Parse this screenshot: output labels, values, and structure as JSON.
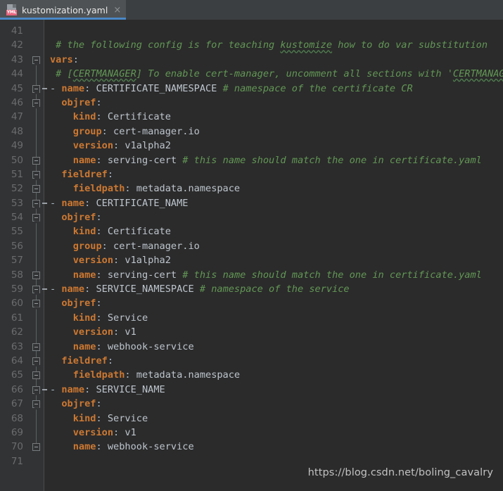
{
  "window": {
    "background": "#2b2b2b",
    "accent": "#4a88c7"
  },
  "tabbar": {
    "tabs": [
      {
        "filename": "kustomization.yaml",
        "icon": "yaml-file-icon",
        "badge_text": "YML",
        "close_glyph": "×",
        "active": true
      }
    ]
  },
  "editor": {
    "first_line_number": 41,
    "colors": {
      "key": "#cc7832",
      "value": "#bdc5cd",
      "comment": "#629755",
      "line_number": "#6a6c6e",
      "gutter_bg": "#313335",
      "editor_bg": "#2b2b2b"
    },
    "lines": [
      {
        "num": 41,
        "fold": "none",
        "segments": []
      },
      {
        "num": 42,
        "fold": "none",
        "segments": [
          {
            "t": "cmt",
            "text": " # the following config is for teaching "
          },
          {
            "t": "cmt-sp",
            "text": "kustomize"
          },
          {
            "t": "cmt",
            "text": " how to do var substitution"
          }
        ]
      },
      {
        "num": 43,
        "fold": "box-point",
        "segments": [
          {
            "t": "key",
            "text": "vars"
          },
          {
            "t": "punc",
            "text": ":"
          }
        ]
      },
      {
        "num": 44,
        "fold": "none",
        "segments": [
          {
            "t": "cmt",
            "text": " # ["
          },
          {
            "t": "cmt-sp",
            "text": "CERTMANAGER"
          },
          {
            "t": "cmt",
            "text": "] To enable cert-manager, uncomment all sections with '"
          },
          {
            "t": "cmt-sp",
            "text": "CERTMANAGER"
          },
          {
            "t": "cmt",
            "text": "'"
          }
        ]
      },
      {
        "num": 45,
        "fold": "box-point-dash",
        "segments": [
          {
            "t": "dash",
            "text": "- "
          },
          {
            "t": "key",
            "text": "name"
          },
          {
            "t": "punc",
            "text": ": "
          },
          {
            "t": "val",
            "text": "CERTIFICATE_NAMESPACE "
          },
          {
            "t": "cmt",
            "text": "# namespace of the certificate CR"
          }
        ]
      },
      {
        "num": 46,
        "fold": "box-point",
        "segments": [
          {
            "t": "plain",
            "text": "  "
          },
          {
            "t": "key",
            "text": "objref"
          },
          {
            "t": "punc",
            "text": ":"
          }
        ]
      },
      {
        "num": 47,
        "fold": "none",
        "segments": [
          {
            "t": "plain",
            "text": "    "
          },
          {
            "t": "key",
            "text": "kind"
          },
          {
            "t": "punc",
            "text": ": "
          },
          {
            "t": "val",
            "text": "Certificate"
          }
        ]
      },
      {
        "num": 48,
        "fold": "none",
        "segments": [
          {
            "t": "plain",
            "text": "    "
          },
          {
            "t": "key",
            "text": "group"
          },
          {
            "t": "punc",
            "text": ": "
          },
          {
            "t": "val",
            "text": "cert-manager.io"
          }
        ]
      },
      {
        "num": 49,
        "fold": "none",
        "segments": [
          {
            "t": "plain",
            "text": "    "
          },
          {
            "t": "key",
            "text": "version"
          },
          {
            "t": "punc",
            "text": ": "
          },
          {
            "t": "val",
            "text": "v1alpha2"
          }
        ]
      },
      {
        "num": 50,
        "fold": "box",
        "segments": [
          {
            "t": "plain",
            "text": "    "
          },
          {
            "t": "key",
            "text": "name"
          },
          {
            "t": "punc",
            "text": ": "
          },
          {
            "t": "val",
            "text": "serving-cert "
          },
          {
            "t": "cmt",
            "text": "# this name should match the one in certificate.yaml"
          }
        ]
      },
      {
        "num": 51,
        "fold": "box-point",
        "segments": [
          {
            "t": "plain",
            "text": "  "
          },
          {
            "t": "key",
            "text": "fieldref"
          },
          {
            "t": "punc",
            "text": ":"
          }
        ]
      },
      {
        "num": 52,
        "fold": "box",
        "segments": [
          {
            "t": "plain",
            "text": "    "
          },
          {
            "t": "key",
            "text": "fieldpath"
          },
          {
            "t": "punc",
            "text": ": "
          },
          {
            "t": "val",
            "text": "metadata.namespace"
          }
        ]
      },
      {
        "num": 53,
        "fold": "box-point-dash",
        "segments": [
          {
            "t": "dash",
            "text": "- "
          },
          {
            "t": "key",
            "text": "name"
          },
          {
            "t": "punc",
            "text": ": "
          },
          {
            "t": "val",
            "text": "CERTIFICATE_NAME"
          }
        ]
      },
      {
        "num": 54,
        "fold": "box-point",
        "segments": [
          {
            "t": "plain",
            "text": "  "
          },
          {
            "t": "key",
            "text": "objref"
          },
          {
            "t": "punc",
            "text": ":"
          }
        ]
      },
      {
        "num": 55,
        "fold": "none",
        "segments": [
          {
            "t": "plain",
            "text": "    "
          },
          {
            "t": "key",
            "text": "kind"
          },
          {
            "t": "punc",
            "text": ": "
          },
          {
            "t": "val",
            "text": "Certificate"
          }
        ]
      },
      {
        "num": 56,
        "fold": "none",
        "segments": [
          {
            "t": "plain",
            "text": "    "
          },
          {
            "t": "key",
            "text": "group"
          },
          {
            "t": "punc",
            "text": ": "
          },
          {
            "t": "val",
            "text": "cert-manager.io"
          }
        ]
      },
      {
        "num": 57,
        "fold": "none",
        "segments": [
          {
            "t": "plain",
            "text": "    "
          },
          {
            "t": "key",
            "text": "version"
          },
          {
            "t": "punc",
            "text": ": "
          },
          {
            "t": "val",
            "text": "v1alpha2"
          }
        ]
      },
      {
        "num": 58,
        "fold": "box",
        "segments": [
          {
            "t": "plain",
            "text": "    "
          },
          {
            "t": "key",
            "text": "name"
          },
          {
            "t": "punc",
            "text": ": "
          },
          {
            "t": "val",
            "text": "serving-cert "
          },
          {
            "t": "cmt",
            "text": "# this name should match the one in certificate.yaml"
          }
        ]
      },
      {
        "num": 59,
        "fold": "box-point-dash",
        "segments": [
          {
            "t": "dash",
            "text": "- "
          },
          {
            "t": "key",
            "text": "name"
          },
          {
            "t": "punc",
            "text": ": "
          },
          {
            "t": "val",
            "text": "SERVICE_NAMESPACE "
          },
          {
            "t": "cmt",
            "text": "# namespace of the service"
          }
        ]
      },
      {
        "num": 60,
        "fold": "box-point",
        "segments": [
          {
            "t": "plain",
            "text": "  "
          },
          {
            "t": "key",
            "text": "objref"
          },
          {
            "t": "punc",
            "text": ":"
          }
        ]
      },
      {
        "num": 61,
        "fold": "none",
        "segments": [
          {
            "t": "plain",
            "text": "    "
          },
          {
            "t": "key",
            "text": "kind"
          },
          {
            "t": "punc",
            "text": ": "
          },
          {
            "t": "val",
            "text": "Service"
          }
        ]
      },
      {
        "num": 62,
        "fold": "none",
        "segments": [
          {
            "t": "plain",
            "text": "    "
          },
          {
            "t": "key",
            "text": "version"
          },
          {
            "t": "punc",
            "text": ": "
          },
          {
            "t": "val",
            "text": "v1"
          }
        ]
      },
      {
        "num": 63,
        "fold": "box",
        "segments": [
          {
            "t": "plain",
            "text": "    "
          },
          {
            "t": "key",
            "text": "name"
          },
          {
            "t": "punc",
            "text": ": "
          },
          {
            "t": "val",
            "text": "webhook-service"
          }
        ]
      },
      {
        "num": 64,
        "fold": "box-point",
        "segments": [
          {
            "t": "plain",
            "text": "  "
          },
          {
            "t": "key",
            "text": "fieldref"
          },
          {
            "t": "punc",
            "text": ":"
          }
        ]
      },
      {
        "num": 65,
        "fold": "box",
        "segments": [
          {
            "t": "plain",
            "text": "    "
          },
          {
            "t": "key",
            "text": "fieldpath"
          },
          {
            "t": "punc",
            "text": ": "
          },
          {
            "t": "val",
            "text": "metadata.namespace"
          }
        ]
      },
      {
        "num": 66,
        "fold": "box-point-dash",
        "segments": [
          {
            "t": "dash",
            "text": "- "
          },
          {
            "t": "key",
            "text": "name"
          },
          {
            "t": "punc",
            "text": ": "
          },
          {
            "t": "val",
            "text": "SERVICE_NAME"
          }
        ]
      },
      {
        "num": 67,
        "fold": "box-point",
        "segments": [
          {
            "t": "plain",
            "text": "  "
          },
          {
            "t": "key",
            "text": "objref"
          },
          {
            "t": "punc",
            "text": ":"
          }
        ]
      },
      {
        "num": 68,
        "fold": "none",
        "segments": [
          {
            "t": "plain",
            "text": "    "
          },
          {
            "t": "key",
            "text": "kind"
          },
          {
            "t": "punc",
            "text": ": "
          },
          {
            "t": "val",
            "text": "Service"
          }
        ]
      },
      {
        "num": 69,
        "fold": "none",
        "segments": [
          {
            "t": "plain",
            "text": "    "
          },
          {
            "t": "key",
            "text": "version"
          },
          {
            "t": "punc",
            "text": ": "
          },
          {
            "t": "val",
            "text": "v1"
          }
        ]
      },
      {
        "num": 70,
        "fold": "box",
        "segments": [
          {
            "t": "plain",
            "text": "    "
          },
          {
            "t": "key",
            "text": "name"
          },
          {
            "t": "punc",
            "text": ": "
          },
          {
            "t": "val",
            "text": "webhook-service"
          }
        ]
      },
      {
        "num": 71,
        "fold": "none",
        "segments": []
      }
    ]
  },
  "watermark": {
    "text": "https://blog.csdn.net/boling_cavalry"
  }
}
